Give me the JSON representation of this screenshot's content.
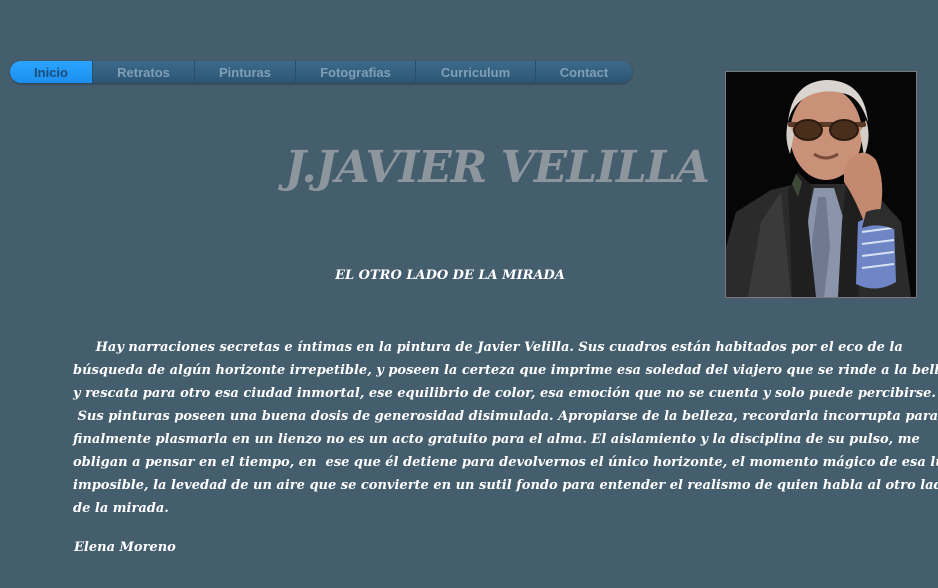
{
  "nav": {
    "items": [
      {
        "label": "Inicio",
        "active": true
      },
      {
        "label": "Retratos",
        "active": false
      },
      {
        "label": "Pinturas",
        "active": false
      },
      {
        "label": "Fotografias",
        "active": false
      },
      {
        "label": "Curriculum",
        "active": false
      },
      {
        "label": "Contact",
        "active": false
      }
    ]
  },
  "header": {
    "title": "J.JAVIER VELILLA"
  },
  "main": {
    "subtitle": "EL OTRO LADO DE LA MIRADA",
    "paragraph_lines": [
      "     Hay narraciones secretas e íntimas en la pintura de Javier Velilla. Sus cuadros están habitados por el eco de la",
      "búsqueda de algún horizonte irrepetible, y poseen la certeza que imprime esa soledad del viajero que se rinde a la belleza",
      "y rescata para otro esa ciudad inmortal, ese equilibrio de color, esa emoción que no se cuenta y solo puede percibirse.",
      " Sus pinturas poseen una buena dosis de generosidad disimulada. Apropiarse de la belleza, recordarla incorrupta para",
      "finalmente plasmarla en un lienzo no es un acto gratuito para el alma. El aislamiento y la disciplina de su pulso, me",
      "obligan a pensar en el tiempo, en  ese que él detiene para devolvernos el único horizonte, el momento mágico de esa luz",
      "imposible, la levedad de un aire que se convierte en un sutil fondo para entender el realismo de quien habla al otro lado",
      "de la mirada."
    ],
    "author": "Elena Moreno"
  },
  "colors": {
    "background": "#455e6e",
    "nav_active": "#1b8fee",
    "title": "#8e969d"
  }
}
